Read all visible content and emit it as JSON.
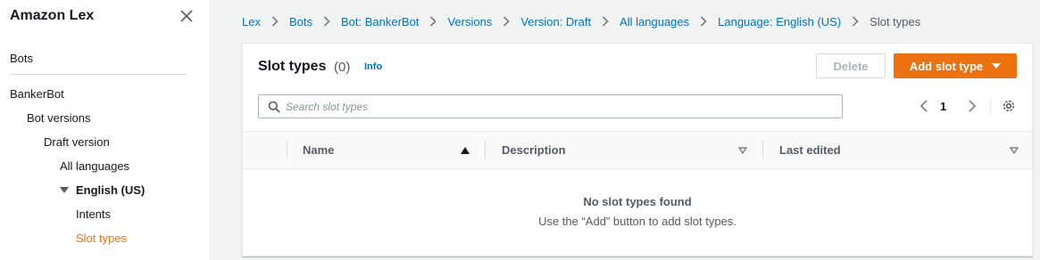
{
  "sidebar": {
    "title": "Amazon Lex",
    "items": {
      "bots": "Bots",
      "bankerbot": "BankerBot",
      "bot_versions": "Bot versions",
      "draft_version": "Draft version",
      "all_languages": "All languages",
      "english_us": "English (US)",
      "intents": "Intents",
      "slot_types": "Slot types"
    }
  },
  "breadcrumb": [
    "Lex",
    "Bots",
    "Bot: BankerBot",
    "Versions",
    "Version: Draft",
    "All languages",
    "Language: English (US)",
    "Slot types"
  ],
  "panel": {
    "title": "Slot types",
    "count": "(0)",
    "info": "Info",
    "delete_label": "Delete",
    "add_label": "Add slot type"
  },
  "search": {
    "placeholder": "Search slot types"
  },
  "pagination": {
    "current_page": "1"
  },
  "table": {
    "columns": {
      "name": "Name",
      "description": "Description",
      "last_edited": "Last edited"
    },
    "empty_title": "No slot types found",
    "empty_subtitle": "Use the “Add” button to add slot types."
  },
  "colors": {
    "accent": "#ec7211",
    "link": "#0073bb"
  }
}
